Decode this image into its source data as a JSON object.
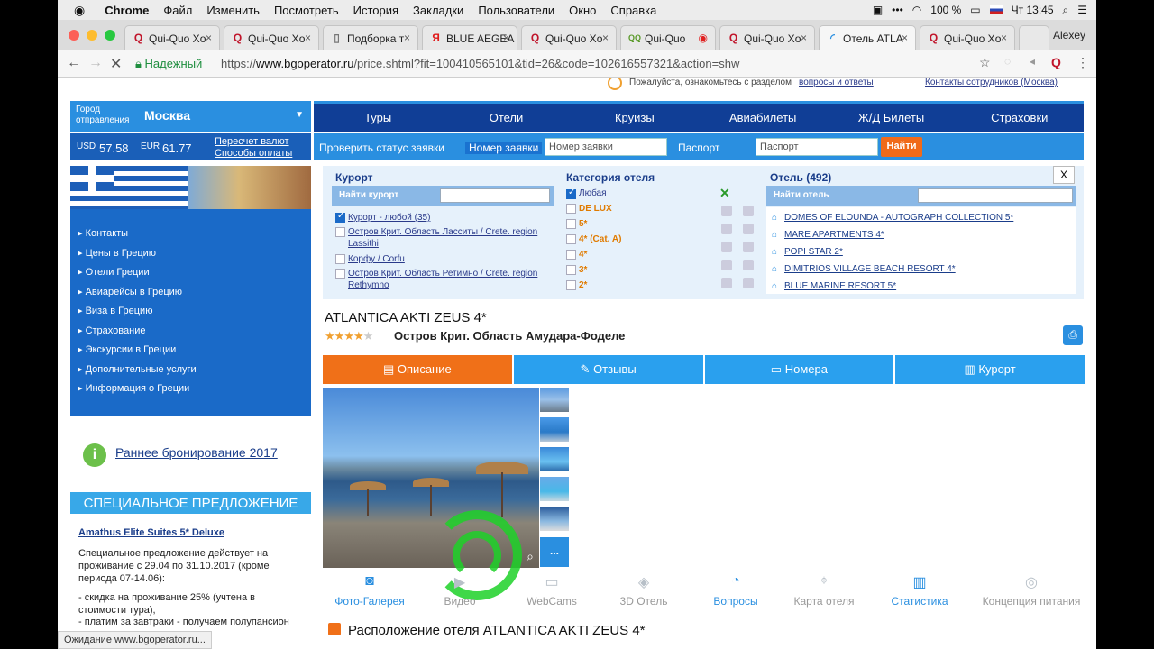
{
  "menubar": {
    "apple": "",
    "app": "Chrome",
    "items": [
      "Файл",
      "Изменить",
      "Посмотреть",
      "История",
      "Закладки",
      "Пользователи",
      "Окно",
      "Справка"
    ],
    "battery": "100 %",
    "clock": "Чт 13:45"
  },
  "tabs": [
    {
      "title": "Qui-Quo Xo",
      "icon": "Q"
    },
    {
      "title": "Qui-Quo Xo",
      "icon": "Q"
    },
    {
      "title": "Подборка т",
      "icon": "doc"
    },
    {
      "title": "BLUE AEGEA",
      "icon": "Я"
    },
    {
      "title": "Qui-Quo Xo",
      "icon": "Q"
    },
    {
      "title": "Qui-Quo",
      "icon": "QQ"
    },
    {
      "title": "Qui-Quo Xo",
      "icon": "Q"
    },
    {
      "title": "Отель ATLA",
      "icon": "loading"
    },
    {
      "title": "Qui-Quo Xo",
      "icon": "Q"
    }
  ],
  "profile": "Alexey",
  "address": {
    "secure": "Надежный",
    "scheme": "https://",
    "host": "www.bgoperator.ru",
    "path": "/price.shtml?fit=100410565101&tid=26&code=102616557321&action=shw"
  },
  "top_notes": {
    "faq_prefix": "Пожалуйста, ознакомьтесь с разделом",
    "faq_link": "вопросы и ответы",
    "staff": "Контакты сотрудников (Москва)"
  },
  "city": {
    "label": "Город отправления",
    "value": "Москва"
  },
  "nav": [
    "Туры",
    "Отели",
    "Круизы",
    "Авиабилеты",
    "Ж/Д Билеты",
    "Страховки"
  ],
  "rates": {
    "usd_label": "USD",
    "usd": "57.58",
    "eur_label": "EUR",
    "eur": "61.77",
    "recalc": "Пересчет валют",
    "pay": "Способы оплаты"
  },
  "status_bar": {
    "check": "Проверить статус заявки",
    "order_label": "Номер заявки",
    "order_placeholder": "Номер заявки",
    "passport_label": "Паспорт",
    "passport_placeholder": "Паспорт",
    "find": "Найти"
  },
  "sidebar": {
    "items": [
      "Контакты",
      "Цены в Грецию",
      "Отели Греции",
      "Авиарейсы в Грецию",
      "Виза в Грецию",
      "Страхование",
      "Экскурсии в Греции",
      "Дополнительные услуги",
      "Информация о Греции"
    ],
    "early": "Раннее бронирование 2017",
    "special_title": "СПЕЦИАЛЬНОЕ ПРЕДЛОЖЕНИЕ",
    "special_link": "Amathus Elite Suites 5* Deluxe",
    "special_text1": "Специальное предложение действует на проживание с 29.04 по 31.10.2017 (кроме периода 07-14.06):",
    "special_text2": "- скидка на проживание 25% (учтена в стоимости тура),",
    "special_text3": "- платим за завтраки - получаем полупансион"
  },
  "filters": {
    "resort_title": "Курорт",
    "resort_search": "Найти курорт",
    "resort_options": [
      "Курорт - любой (35)",
      "Остров Крит. Область Ласситы / Crete. region Lassithi",
      "Корфу / Corfu",
      "Остров Крит. Область Ретимно / Crete. region Rethymno"
    ],
    "category_title": "Категория отеля",
    "categories": [
      "Любая",
      "DE LUX",
      "5*",
      "4* (Cat. A)",
      "4*",
      "3*",
      "2*"
    ],
    "hotel_title": "Отель (492)",
    "hotel_search": "Найти отель",
    "hotels": [
      "DOMES OF ELOUNDA - AUTOGRAPH COLLECTION 5*",
      "MARE APARTMENTS 4*",
      "POPI STAR 2*",
      "DIMITRIOS VILLAGE BEACH RESORT 4*",
      "BLUE MARINE RESORT 5*"
    ],
    "close": "X"
  },
  "hotel": {
    "name": "ATLANTICA AKTI ZEUS 4*",
    "stars": 4,
    "stars_max": 5,
    "region": "Остров Крит. Область Амудара-Фоделе",
    "tabs": [
      "Описание",
      "Отзывы",
      "Номера",
      "Курорт"
    ],
    "features": [
      "Фото-Галерея",
      "Видео",
      "WebCams",
      "3D Отель",
      "Вопросы",
      "Карта отеля",
      "Статистика",
      "Концепция питания"
    ],
    "more": "...",
    "location": "Расположение отеля ATLANTICA AKTI ZEUS 4*"
  },
  "browser_status": "Ожидание www.bgoperator.ru...",
  "colors": {
    "accent": "#2a8fe0",
    "nav": "#103e96",
    "active_tab": "#f07018"
  }
}
